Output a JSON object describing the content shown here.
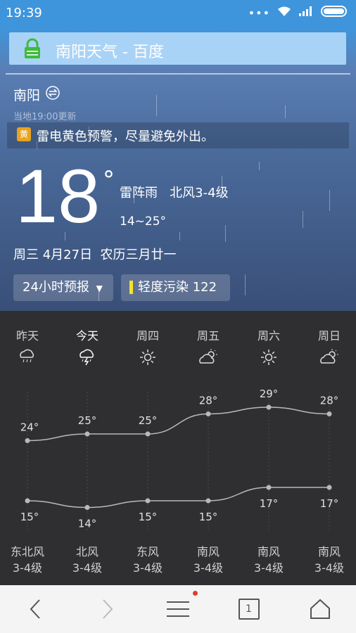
{
  "status": {
    "time": "19:39"
  },
  "address_bar": {
    "title": "南阳天气 - 百度"
  },
  "current": {
    "city": "南阳",
    "updated": "当地19:00更新",
    "alert_badge": "黄",
    "alert_text": "雷电黄色预警，尽量避免外出。",
    "temp": "18",
    "deg": "°",
    "condition": "雷阵雨   北风3-4级",
    "range": "14~25°",
    "date": "周三 4月27日  农历三月廿一",
    "forecast_btn": "24小时预报",
    "aqi_btn": "轻度污染 122"
  },
  "forecast": {
    "days": [
      {
        "name": "昨天",
        "icon": "rain-cloud-icon",
        "high": "24°",
        "low": "15°",
        "wind": "东北风",
        "level": "3-4级"
      },
      {
        "name": "今天",
        "icon": "thunder-rain-icon",
        "high": "25°",
        "low": "14°",
        "wind": "北风",
        "level": "3-4级"
      },
      {
        "name": "周四",
        "icon": "sun-icon",
        "high": "25°",
        "low": "15°",
        "wind": "东风",
        "level": "3-4级"
      },
      {
        "name": "周五",
        "icon": "partly-cloudy-icon",
        "high": "28°",
        "low": "15°",
        "wind": "南风",
        "level": "3-4级"
      },
      {
        "name": "周六",
        "icon": "sun-icon",
        "high": "29°",
        "low": "17°",
        "wind": "南风",
        "level": "3-4级"
      },
      {
        "name": "周日",
        "icon": "partly-cloudy-icon",
        "high": "28°",
        "low": "17°",
        "wind": "南风",
        "level": "3-4级"
      }
    ]
  },
  "chart_data": {
    "type": "line",
    "categories": [
      "昨天",
      "今天",
      "周四",
      "周五",
      "周六",
      "周日"
    ],
    "series": [
      {
        "values": [
          24,
          25,
          25,
          28,
          29,
          28
        ]
      },
      {
        "values": [
          15,
          14,
          15,
          15,
          17,
          17
        ]
      }
    ]
  },
  "bottom_nav": {
    "tab_count": "1"
  }
}
